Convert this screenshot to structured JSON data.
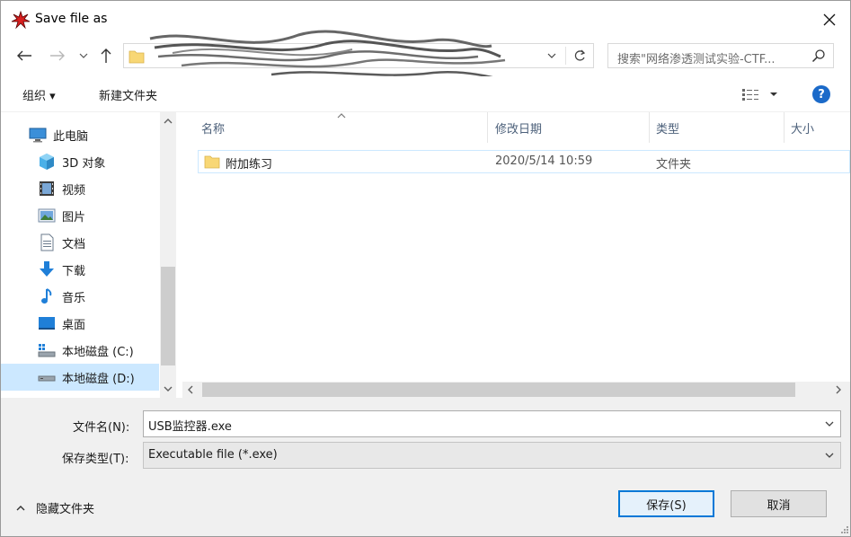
{
  "window": {
    "title": "Save file as"
  },
  "search": {
    "placeholder": "搜索\"网络渗透测试实验-CTF..."
  },
  "toolbar": {
    "organize_label": "组织 ▾",
    "new_folder_label": "新建文件夹"
  },
  "nav": {
    "items": [
      {
        "label": "此电脑",
        "icon": "computer-icon"
      },
      {
        "label": "3D 对象",
        "icon": "cube-icon"
      },
      {
        "label": "视频",
        "icon": "video-icon"
      },
      {
        "label": "图片",
        "icon": "picture-icon"
      },
      {
        "label": "文档",
        "icon": "document-icon"
      },
      {
        "label": "下载",
        "icon": "download-icon"
      },
      {
        "label": "音乐",
        "icon": "music-icon"
      },
      {
        "label": "桌面",
        "icon": "desktop-icon"
      },
      {
        "label": "本地磁盘 (C:)",
        "icon": "drive-c-icon"
      },
      {
        "label": "本地磁盘 (D:)",
        "icon": "drive-d-icon",
        "selected": true
      }
    ]
  },
  "columns": {
    "name": "名称",
    "date": "修改日期",
    "type": "类型",
    "size": "大小"
  },
  "files": [
    {
      "name": "附加练习",
      "date": "2020/5/14 10:59",
      "type": "文件夹",
      "size": ""
    }
  ],
  "form": {
    "filename_label": "文件名(N):",
    "filename_value": "USB监控器.exe",
    "filetype_label": "保存类型(T):",
    "filetype_value": "Executable file (*.exe)"
  },
  "footer": {
    "hide_folders_label": "隐藏文件夹",
    "save_label": "保存(S)",
    "cancel_label": "取消"
  },
  "colors": {
    "accent": "#0078d7",
    "selection": "#cce8ff",
    "folder": "#f8d775",
    "help": "#1b6ac9"
  }
}
